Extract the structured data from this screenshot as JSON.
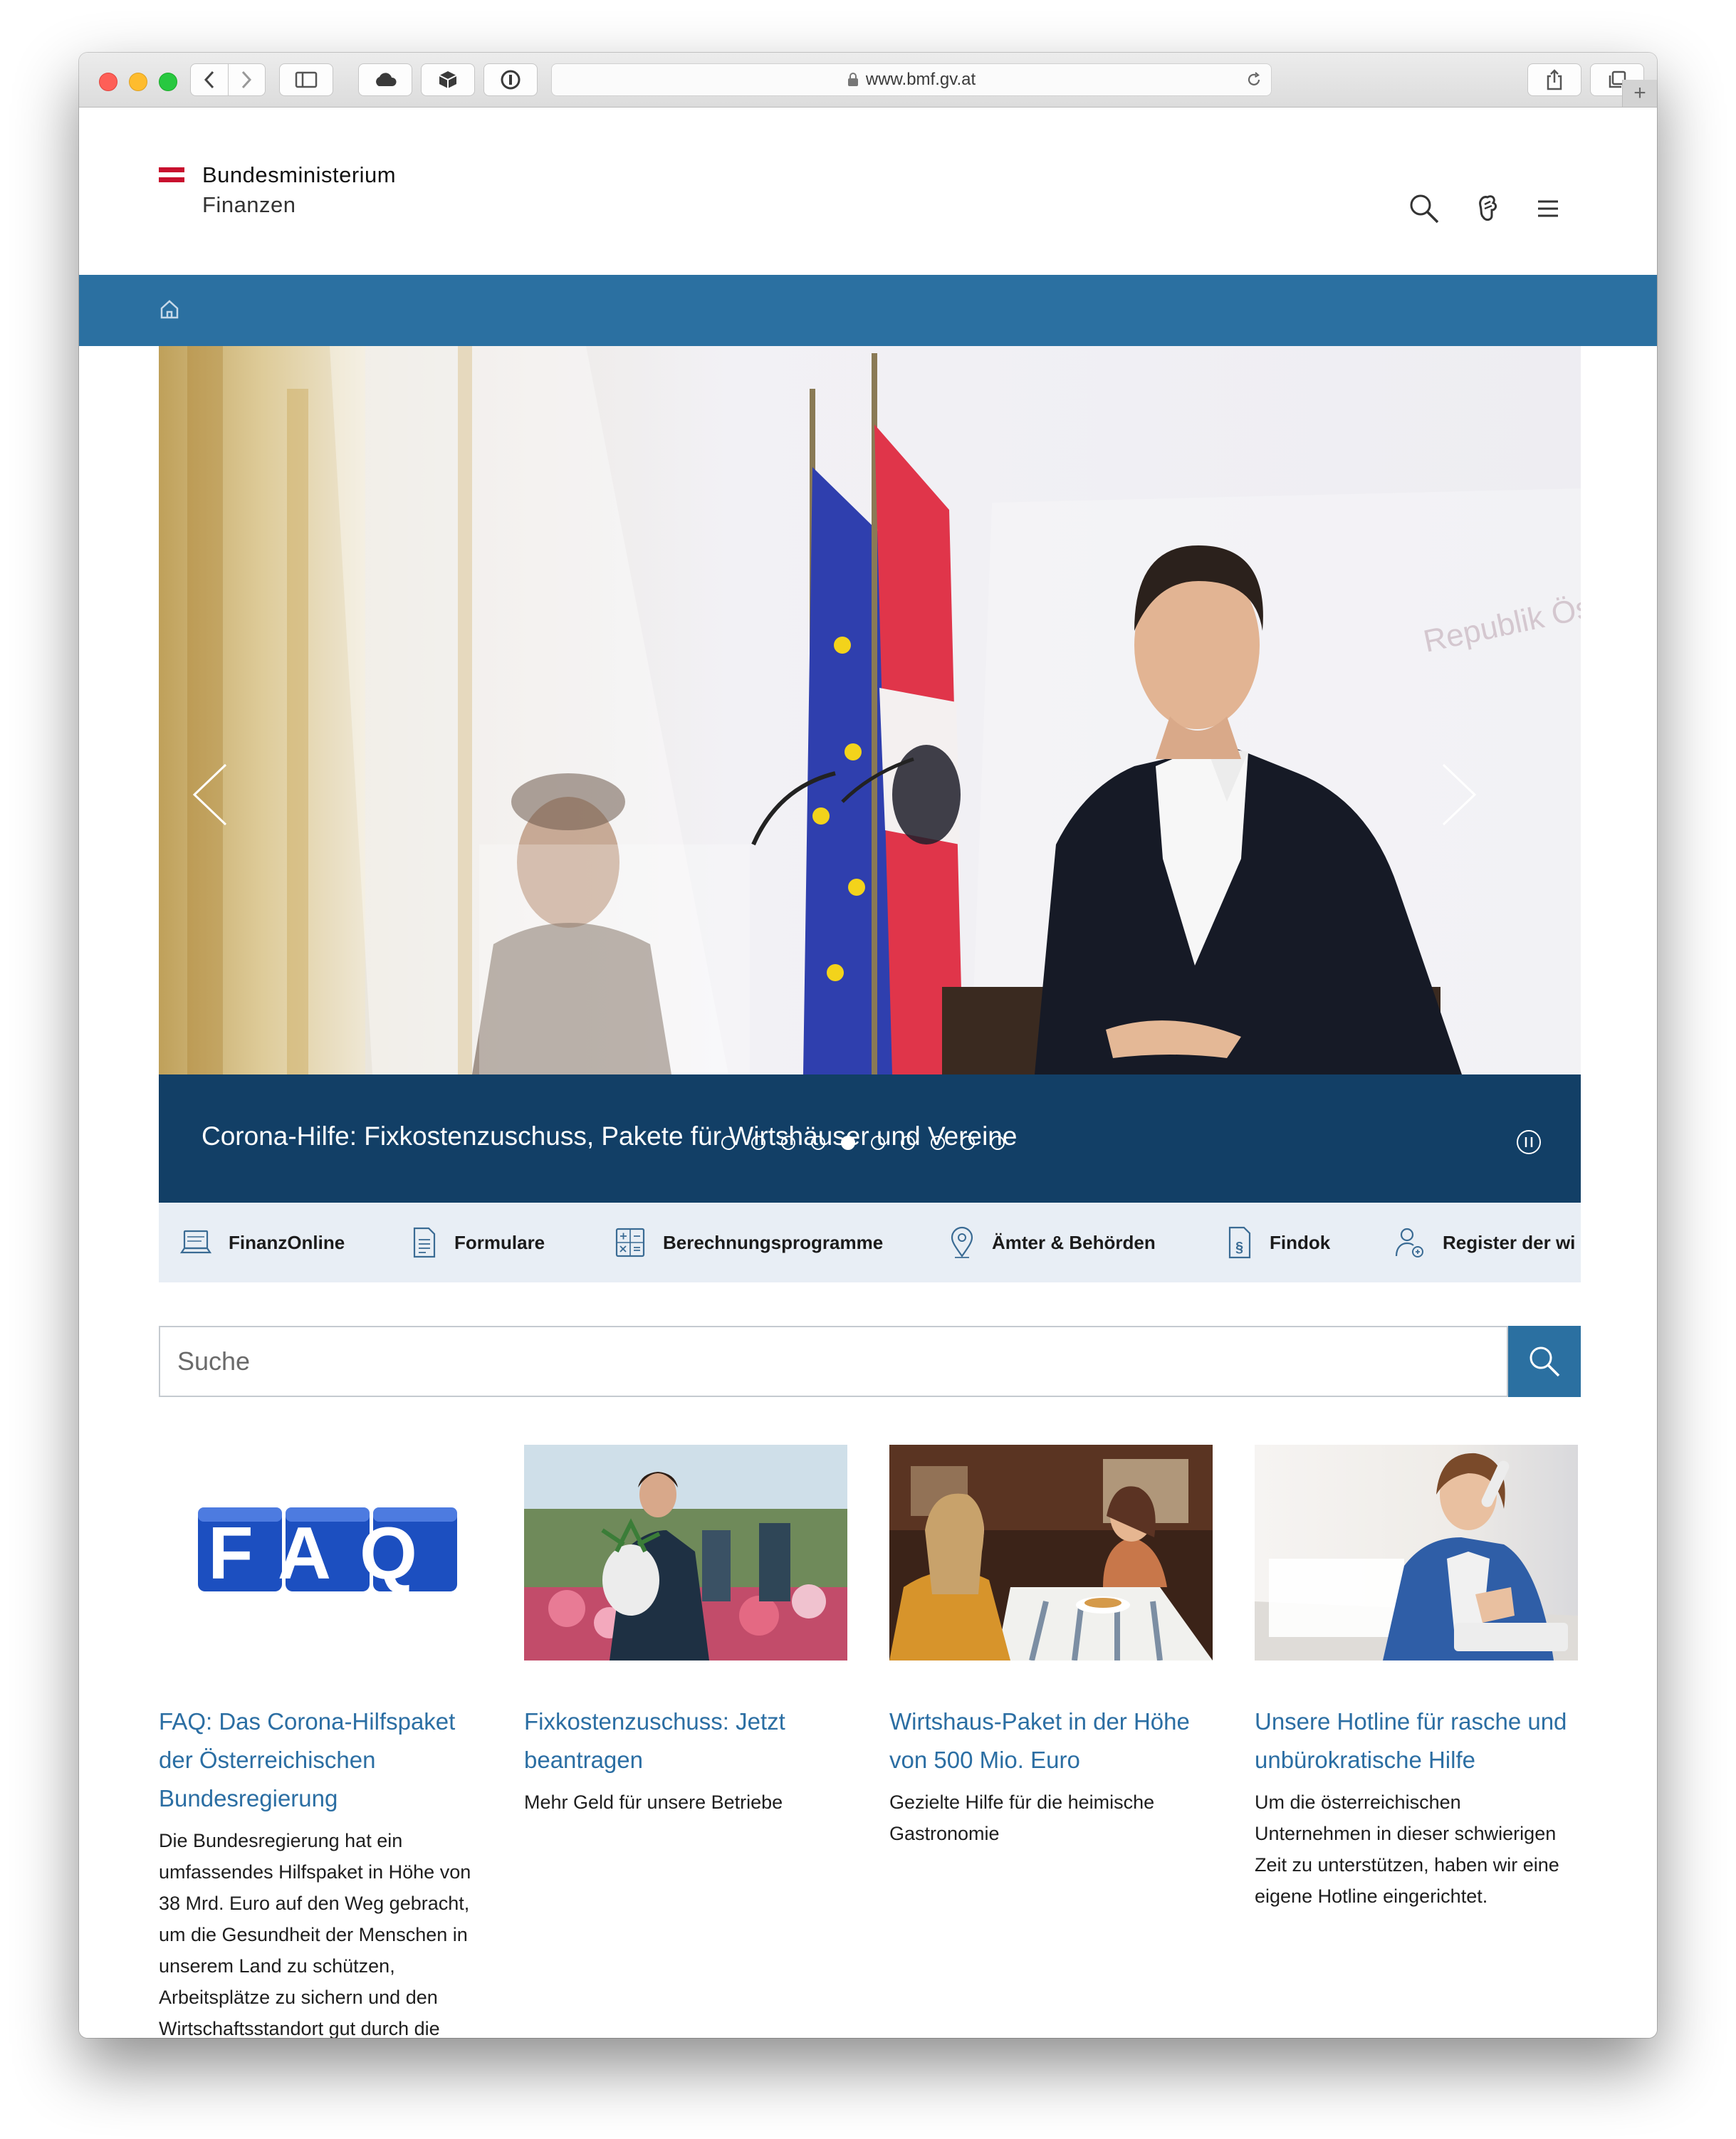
{
  "browser": {
    "url": "www.bmf.gv.at"
  },
  "site": {
    "logo_line1": "Bundesministerium",
    "logo_line2": "Finanzen",
    "flag_colors": [
      "#c8102e",
      "#ffffff",
      "#c8102e"
    ]
  },
  "hero": {
    "caption": "Corona-Hilfe: Fixkostenzuschuss, Pakete für Wirtshäuser und Vereine",
    "slide_count": 10,
    "active_slide": 4,
    "watermark": "Republik Ös"
  },
  "quick_links": [
    {
      "label": "FinanzOnline",
      "icon": "laptop-icon"
    },
    {
      "label": "Formulare",
      "icon": "document-icon"
    },
    {
      "label": "Berechnungsprogramme",
      "icon": "calculator-icon"
    },
    {
      "label": "Ämter & Behörden",
      "icon": "location-pin-icon"
    },
    {
      "label": "Findok",
      "icon": "paragraph-document-icon"
    },
    {
      "label": "Register der wi",
      "icon": "person-icon"
    }
  ],
  "search": {
    "placeholder": "Suche"
  },
  "cards": [
    {
      "image_text": "FAQ",
      "title": "FAQ: Das Corona-Hilfspaket der Österreichischen Bundesregierung",
      "desc": "Die Bundesregierung hat ein umfassendes Hilfspaket in Höhe von 38 Mrd. Euro auf den Weg gebracht, um die Gesundheit der Menschen in unserem Land zu schützen, Arbeitsplätze zu sichern und den Wirtschaftsstandort gut durch die"
    },
    {
      "title": "Fixkostenzuschuss: Jetzt beantragen",
      "desc": "Mehr Geld für unsere Betriebe"
    },
    {
      "title": "Wirtshaus-Paket in der Höhe von 500 Mio. Euro",
      "desc": "Gezielte Hilfe für die heimische Gastronomie"
    },
    {
      "title": "Unsere Hotline für rasche und unbürokratische Hilfe",
      "desc": "Um die österreichischen Unternehmen in dieser schwierigen Zeit zu unterstützen, haben wir eine eigene Hotline eingerichtet."
    }
  ],
  "colors": {
    "primary_blue": "#2b70a1",
    "caption_navy": "#123f66",
    "link_blue": "#2b6ea3",
    "quicklinks_bg": "#e8eef5"
  }
}
